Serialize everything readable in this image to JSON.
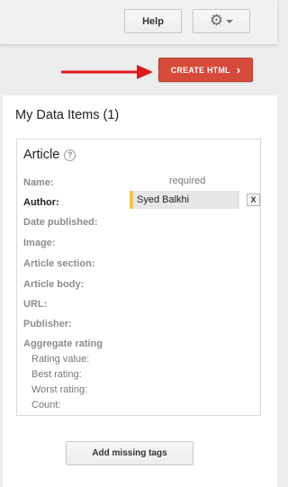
{
  "toolbar": {
    "help_label": "Help",
    "gear_icon": "gear-icon",
    "create_label": "CREATE HTML",
    "create_color": "#d64a39",
    "arrow_color": "#e0151e"
  },
  "panel": {
    "title": "My Data Items (1)",
    "card": {
      "title": "Article",
      "help_icon": "?",
      "required_note": "required",
      "fields": [
        {
          "label": "Name:"
        },
        {
          "label": "Author:",
          "value": "Syed Balkhi"
        },
        {
          "label": "Date published:"
        },
        {
          "label": "Image:"
        },
        {
          "label": "Article section:"
        },
        {
          "label": "Article body:"
        },
        {
          "label": "URL:"
        },
        {
          "label": "Publisher:"
        },
        {
          "label": "Aggregate rating"
        }
      ],
      "remove_label": "X",
      "rating_subfields": [
        "Rating value:",
        "Best rating:",
        "Worst rating:",
        "Count:"
      ]
    },
    "add_missing_label": "Add missing tags"
  }
}
